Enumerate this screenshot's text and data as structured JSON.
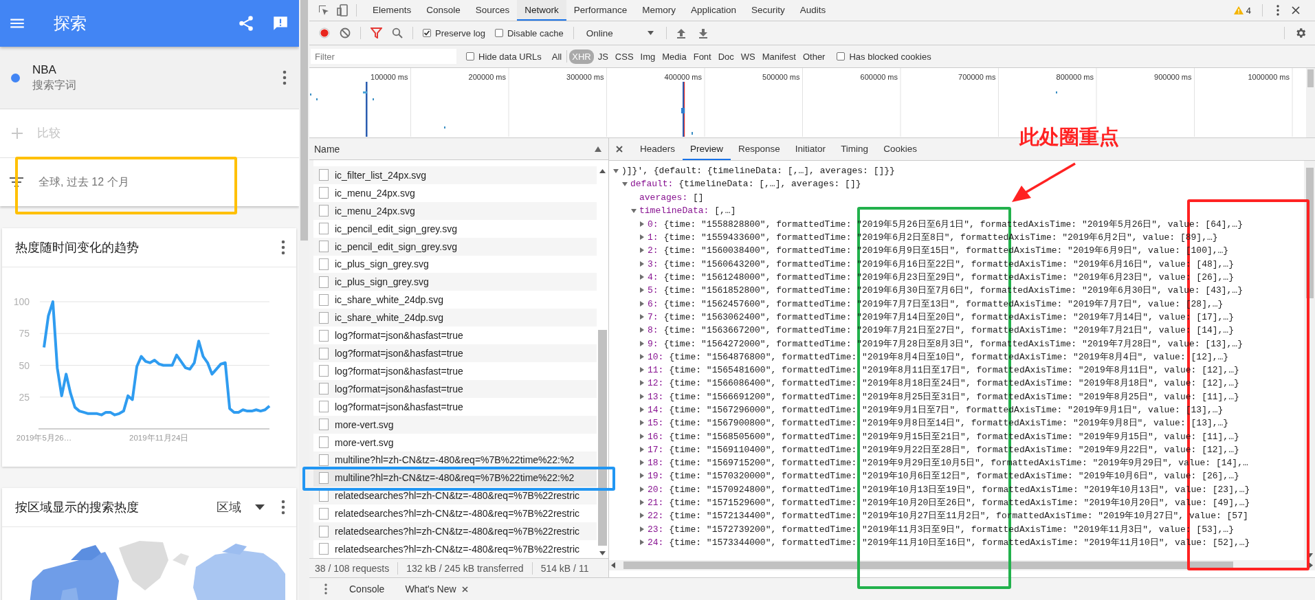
{
  "explore_app": {
    "app_bar": {
      "title": "探索"
    },
    "search_term": {
      "name": "NBA",
      "subtitle": "搜索字词",
      "color": "#4285f4"
    },
    "compare": {
      "placeholder": "比较"
    },
    "filter": {
      "label": "全球, 过去 12 个月"
    },
    "trend_card": {
      "title": "热度随时间变化的趋势",
      "chart_data": {
        "type": "line",
        "ylim": [
          0,
          100
        ],
        "yticks": [
          25,
          50,
          75,
          100
        ],
        "grid": true,
        "series": [
          {
            "color": "#2f9cf0",
            "values": [
              64,
              89,
              100,
              48,
              26,
              43,
              28,
              17,
              14,
              13,
              12,
              12,
              12,
              11,
              13,
              13,
              11,
              12,
              14,
              26,
              23,
              49,
              57,
              53,
              52,
              54,
              51,
              50,
              50,
              50,
              58,
              53,
              48,
              47,
              52,
              69,
              57,
              52,
              43,
              47,
              51,
              52,
              16,
              13,
              13,
              15,
              14,
              14,
              15,
              14,
              15,
              18
            ]
          }
        ]
      },
      "axis_labels": [
        "2019年5月26…",
        "2019年11月24日"
      ]
    },
    "region_card": {
      "title": "按区域显示的搜索热度",
      "dropdown": "区域"
    }
  },
  "devtools": {
    "tabs": [
      {
        "label": "Elements",
        "selected": false
      },
      {
        "label": "Console",
        "selected": false
      },
      {
        "label": "Sources",
        "selected": false
      },
      {
        "label": "Network",
        "selected": true
      },
      {
        "label": "Performance",
        "selected": false
      },
      {
        "label": "Memory",
        "selected": false
      },
      {
        "label": "Application",
        "selected": false
      },
      {
        "label": "Security",
        "selected": false
      },
      {
        "label": "Audits",
        "selected": false
      }
    ],
    "warnings": "4",
    "toolbar": {
      "recording": true,
      "filter_shown": true,
      "preserve_log": {
        "label": "Preserve log",
        "checked": true
      },
      "disable_cache": {
        "label": "Disable cache",
        "checked": false
      },
      "throttling": "Online"
    },
    "filter_bar": {
      "placeholder": "Filter",
      "hide_data_urls": {
        "label": "Hide data URLs",
        "checked": false
      },
      "types": [
        {
          "label": "All",
          "selected": false
        },
        {
          "label": "XHR",
          "selected": true
        },
        {
          "label": "JS",
          "selected": false
        },
        {
          "label": "CSS",
          "selected": false
        },
        {
          "label": "Img",
          "selected": false
        },
        {
          "label": "Media",
          "selected": false
        },
        {
          "label": "Font",
          "selected": false
        },
        {
          "label": "Doc",
          "selected": false
        },
        {
          "label": "WS",
          "selected": false
        },
        {
          "label": "Manifest",
          "selected": false
        },
        {
          "label": "Other",
          "selected": false
        }
      ],
      "has_blocked_cookies": {
        "label": "Has blocked cookies",
        "checked": false
      }
    },
    "overview_ticks": [
      "100000 ms",
      "200000 ms",
      "300000 ms",
      "400000 ms",
      "500000 ms",
      "600000 ms",
      "700000 ms",
      "800000 ms",
      "900000 ms",
      "1000000 ms"
    ],
    "requests": {
      "header": "Name",
      "rows": [
        {
          "name": "ic_filter_list_24px.svg",
          "selected": false
        },
        {
          "name": "ic_menu_24px.svg",
          "selected": false
        },
        {
          "name": "ic_menu_24px.svg",
          "selected": false
        },
        {
          "name": "ic_pencil_edit_sign_grey.svg",
          "selected": false
        },
        {
          "name": "ic_pencil_edit_sign_grey.svg",
          "selected": false
        },
        {
          "name": "ic_plus_sign_grey.svg",
          "selected": false
        },
        {
          "name": "ic_plus_sign_grey.svg",
          "selected": false
        },
        {
          "name": "ic_share_white_24dp.svg",
          "selected": false
        },
        {
          "name": "ic_share_white_24dp.svg",
          "selected": false
        },
        {
          "name": "log?format=json&hasfast=true",
          "selected": false
        },
        {
          "name": "log?format=json&hasfast=true",
          "selected": false
        },
        {
          "name": "log?format=json&hasfast=true",
          "selected": false
        },
        {
          "name": "log?format=json&hasfast=true",
          "selected": false
        },
        {
          "name": "log?format=json&hasfast=true",
          "selected": false
        },
        {
          "name": "more-vert.svg",
          "selected": false
        },
        {
          "name": "more-vert.svg",
          "selected": false
        },
        {
          "name": "multiline?hl=zh-CN&tz=-480&req=%7B%22time%22:%2",
          "selected": false
        },
        {
          "name": "multiline?hl=zh-CN&tz=-480&req=%7B%22time%22:%2",
          "selected": true
        },
        {
          "name": "relatedsearches?hl=zh-CN&tz=-480&req=%7B%22restric",
          "selected": false
        },
        {
          "name": "relatedsearches?hl=zh-CN&tz=-480&req=%7B%22restric",
          "selected": false
        },
        {
          "name": "relatedsearches?hl=zh-CN&tz=-480&req=%7B%22restric",
          "selected": false
        },
        {
          "name": "relatedsearches?hl=zh-CN&tz=-480&req=%7B%22restric",
          "selected": false
        }
      ]
    },
    "status": [
      "38 / 108 requests",
      "132 kB / 245 kB transferred",
      "514 kB / 11"
    ],
    "detail_tabs": [
      {
        "label": "Headers",
        "selected": false
      },
      {
        "label": "Preview",
        "selected": true
      },
      {
        "label": "Response",
        "selected": false
      },
      {
        "label": "Initiator",
        "selected": false
      },
      {
        "label": "Timing",
        "selected": false
      },
      {
        "label": "Cookies",
        "selected": false
      }
    ],
    "preview_tree": [
      {
        "text": ")]}', {default: {timelineData: [,…], averages: []}}",
        "expanded": true,
        "children": [
          {
            "key": "default:",
            "text": "{timelineData: [,…], averages: []}",
            "expanded": true,
            "children": [
              {
                "key": "averages:",
                "text": "[]"
              },
              {
                "key": "timelineData:",
                "text": "[,…]",
                "expanded": true,
                "children": [
                  {
                    "key": "0:",
                    "text": "{time: \"1558828800\", formattedTime: \"2019年5月26日至6月1日\", formattedAxisTime: \"2019年5月26日\", value: [64],…}",
                    "expanded": false
                  },
                  {
                    "key": "1:",
                    "text": "{time: \"1559433600\", formattedTime: \"2019年6月2日至8日\", formattedAxisTime: \"2019年6月2日\", value: [89],…}",
                    "expanded": false
                  },
                  {
                    "key": "2:",
                    "text": "{time: \"1560038400\", formattedTime: \"2019年6月9日至15日\", formattedAxisTime: \"2019年6月9日\", value: [100],…}",
                    "expanded": false
                  },
                  {
                    "key": "3:",
                    "text": "{time: \"1560643200\", formattedTime: \"2019年6月16日至22日\", formattedAxisTime: \"2019年6月16日\", value: [48],…}",
                    "expanded": false
                  },
                  {
                    "key": "4:",
                    "text": "{time: \"1561248000\", formattedTime: \"2019年6月23日至29日\", formattedAxisTime: \"2019年6月23日\", value: [26],…}",
                    "expanded": false
                  },
                  {
                    "key": "5:",
                    "text": "{time: \"1561852800\", formattedTime: \"2019年6月30日至7月6日\", formattedAxisTime: \"2019年6月30日\", value: [43],…}",
                    "expanded": false
                  },
                  {
                    "key": "6:",
                    "text": "{time: \"1562457600\", formattedTime: \"2019年7月7日至13日\", formattedAxisTime: \"2019年7月7日\", value: [28],…}",
                    "expanded": false
                  },
                  {
                    "key": "7:",
                    "text": "{time: \"1563062400\", formattedTime: \"2019年7月14日至20日\", formattedAxisTime: \"2019年7月14日\", value: [17],…}",
                    "expanded": false
                  },
                  {
                    "key": "8:",
                    "text": "{time: \"1563667200\", formattedTime: \"2019年7月21日至27日\", formattedAxisTime: \"2019年7月21日\", value: [14],…}",
                    "expanded": false
                  },
                  {
                    "key": "9:",
                    "text": "{time: \"1564272000\", formattedTime: \"2019年7月28日至8月3日\", formattedAxisTime: \"2019年7月28日\", value: [13],…}",
                    "expanded": false
                  },
                  {
                    "key": "10:",
                    "text": "{time: \"1564876800\", formattedTime: \"2019年8月4日至10日\", formattedAxisTime: \"2019年8月4日\", value: [12],…}",
                    "expanded": false
                  },
                  {
                    "key": "11:",
                    "text": "{time: \"1565481600\", formattedTime: \"2019年8月11日至17日\", formattedAxisTime: \"2019年8月11日\", value: [12],…}",
                    "expanded": false
                  },
                  {
                    "key": "12:",
                    "text": "{time: \"1566086400\", formattedTime: \"2019年8月18日至24日\", formattedAxisTime: \"2019年8月18日\", value: [12],…}",
                    "expanded": false
                  },
                  {
                    "key": "13:",
                    "text": "{time: \"1566691200\", formattedTime: \"2019年8月25日至31日\", formattedAxisTime: \"2019年8月25日\", value: [11],…}",
                    "expanded": false
                  },
                  {
                    "key": "14:",
                    "text": "{time: \"1567296000\", formattedTime: \"2019年9月1日至7日\", formattedAxisTime: \"2019年9月1日\", value: [13],…}",
                    "expanded": false
                  },
                  {
                    "key": "15:",
                    "text": "{time: \"1567900800\", formattedTime: \"2019年9月8日至14日\", formattedAxisTime: \"2019年9月8日\", value: [13],…}",
                    "expanded": false
                  },
                  {
                    "key": "16:",
                    "text": "{time: \"1568505600\", formattedTime: \"2019年9月15日至21日\", formattedAxisTime: \"2019年9月15日\", value: [11],…}",
                    "expanded": false
                  },
                  {
                    "key": "17:",
                    "text": "{time: \"1569110400\", formattedTime: \"2019年9月22日至28日\", formattedAxisTime: \"2019年9月22日\", value: [12],…}",
                    "expanded": false
                  },
                  {
                    "key": "18:",
                    "text": "{time: \"1569715200\", formattedTime: \"2019年9月29日至10月5日\", formattedAxisTime: \"2019年9月29日\", value: [14],…",
                    "expanded": false
                  },
                  {
                    "key": "19:",
                    "text": "{time: \"1570320000\", formattedTime: \"2019年10月6日至12日\", formattedAxisTime: \"2019年10月6日\", value: [26],…}",
                    "expanded": false
                  },
                  {
                    "key": "20:",
                    "text": "{time: \"1570924800\", formattedTime: \"2019年10月13日至19日\", formattedAxisTime: \"2019年10月13日\", value: [23],…}",
                    "expanded": false
                  },
                  {
                    "key": "21:",
                    "text": "{time: \"1571529600\", formattedTime: \"2019年10月20日至26日\", formattedAxisTime: \"2019年10月20日\", value: [49],…}",
                    "expanded": false
                  },
                  {
                    "key": "22:",
                    "text": "{time: \"1572134400\", formattedTime: \"2019年10月27日至11月2日\", formattedAxisTime: \"2019年10月27日\", value: [57]",
                    "expanded": false
                  },
                  {
                    "key": "23:",
                    "text": "{time: \"1572739200\", formattedTime: \"2019年11月3日至9日\", formattedAxisTime: \"2019年11月3日\", value: [53],…}",
                    "expanded": false
                  },
                  {
                    "key": "24:",
                    "text": "{time: \"1573344000\", formattedTime: \"2019年11月10日至16日\", formattedAxisTime: \"2019年11月10日\", value: [52],…}",
                    "expanded": false
                  }
                ]
              }
            ]
          }
        ]
      }
    ],
    "drawer_tabs": [
      {
        "label": "Console",
        "closable": false
      },
      {
        "label": "What's New",
        "closable": true
      }
    ]
  },
  "annotations": [
    {
      "kind": "box",
      "color": "#ffc000"
    },
    {
      "kind": "box",
      "color": "#22b14c"
    },
    {
      "kind": "box",
      "color": "#ff2222"
    },
    {
      "kind": "box",
      "color": "#2196f3"
    },
    {
      "kind": "arrow",
      "color": "#ff2222"
    },
    {
      "kind": "label",
      "text": "此处圈重点",
      "color": "#ff2222"
    }
  ]
}
